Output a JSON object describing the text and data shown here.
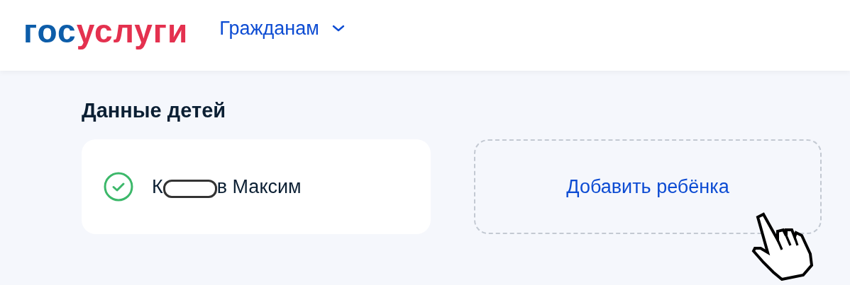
{
  "header": {
    "logo": {
      "part_1": "гос",
      "part_2": "услуги"
    },
    "menu": {
      "label": "Гражданам",
      "expanded": false
    }
  },
  "section": {
    "title": "Данные детей"
  },
  "children": [
    {
      "name_start": "К",
      "name_end": "в Максим",
      "redacted": true,
      "verified": true
    }
  ],
  "add_button": {
    "label": "Добавить ребёнка"
  }
}
